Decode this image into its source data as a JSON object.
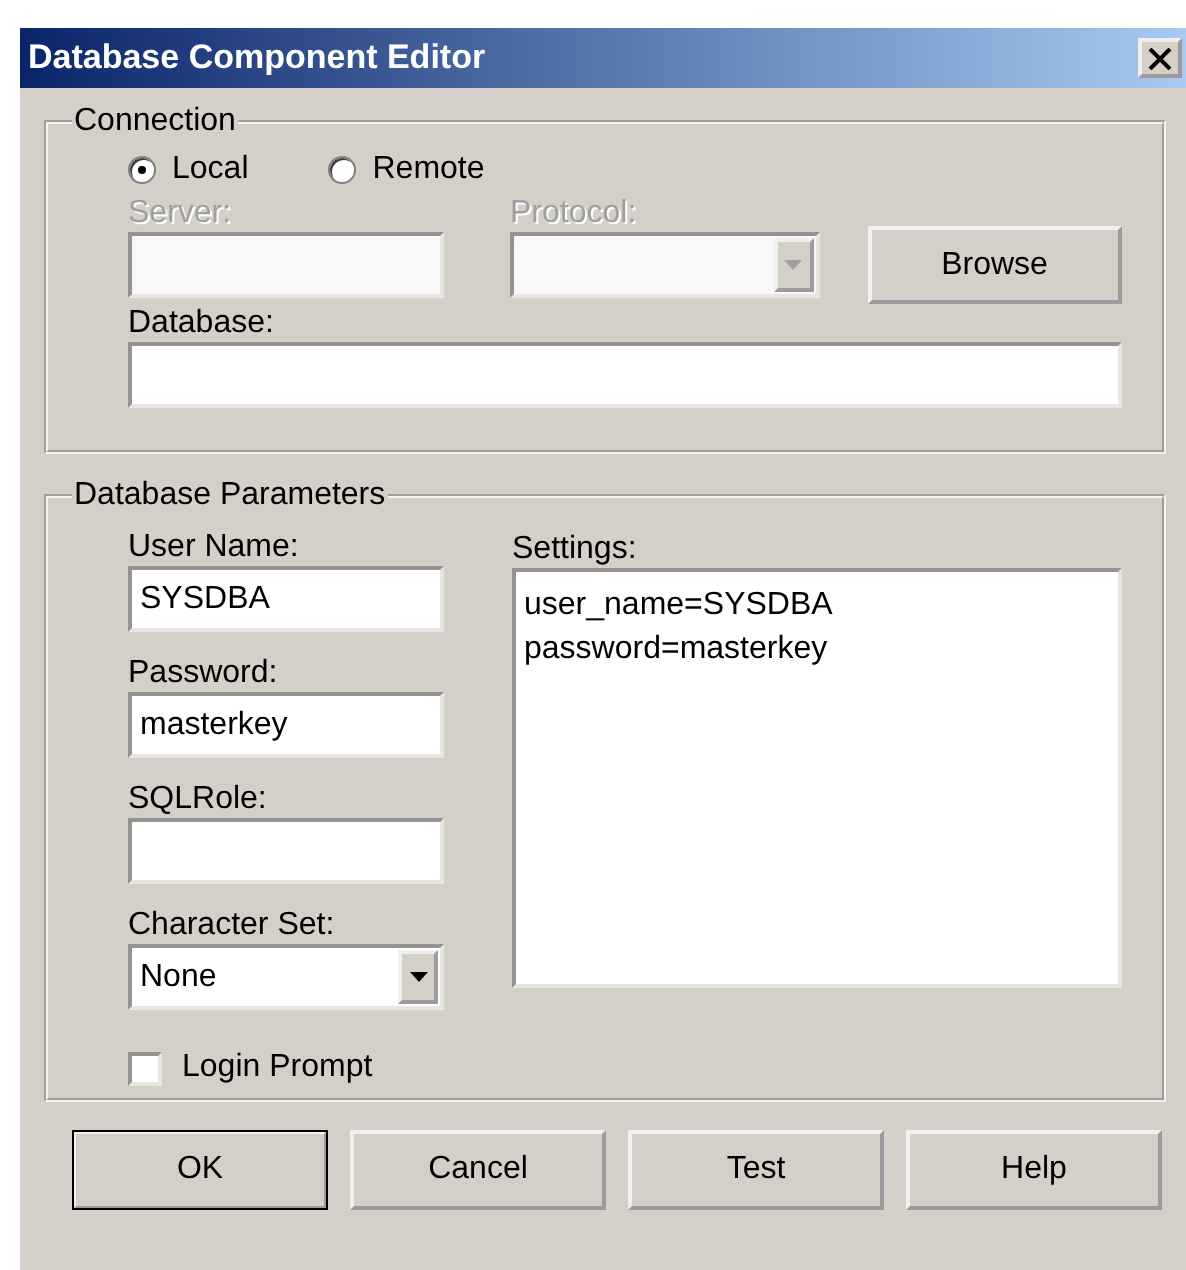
{
  "window": {
    "title": "Database Component Editor"
  },
  "connection": {
    "title": "Connection",
    "modes": [
      {
        "label": "Local",
        "selected": true
      },
      {
        "label": "Remote",
        "selected": false
      }
    ],
    "server": {
      "label": "Server:",
      "disabled": true
    },
    "protocol": {
      "label": "Protocol:",
      "disabled": true
    },
    "browse": "Browse",
    "database": {
      "label": "Database:"
    }
  },
  "parameters": {
    "title": "Database Parameters",
    "user_name": {
      "label": "User Name:",
      "value": "SYSDBA"
    },
    "password": {
      "label": "Password:",
      "value": "masterkey"
    },
    "sql_role": {
      "label": "SQLRole:"
    },
    "character_set": {
      "label": "Character Set:",
      "value": "None"
    },
    "login_prompt": {
      "label": "Login Prompt",
      "checked": false
    },
    "settings": {
      "label": "Settings:",
      "lines": [
        "user_name=SYSDBA",
        "password=masterkey"
      ]
    }
  },
  "buttons": [
    {
      "label": "OK",
      "default": true
    },
    {
      "label": "Cancel",
      "default": false
    },
    {
      "label": "Test",
      "default": false
    },
    {
      "label": "Help",
      "default": false
    }
  ]
}
